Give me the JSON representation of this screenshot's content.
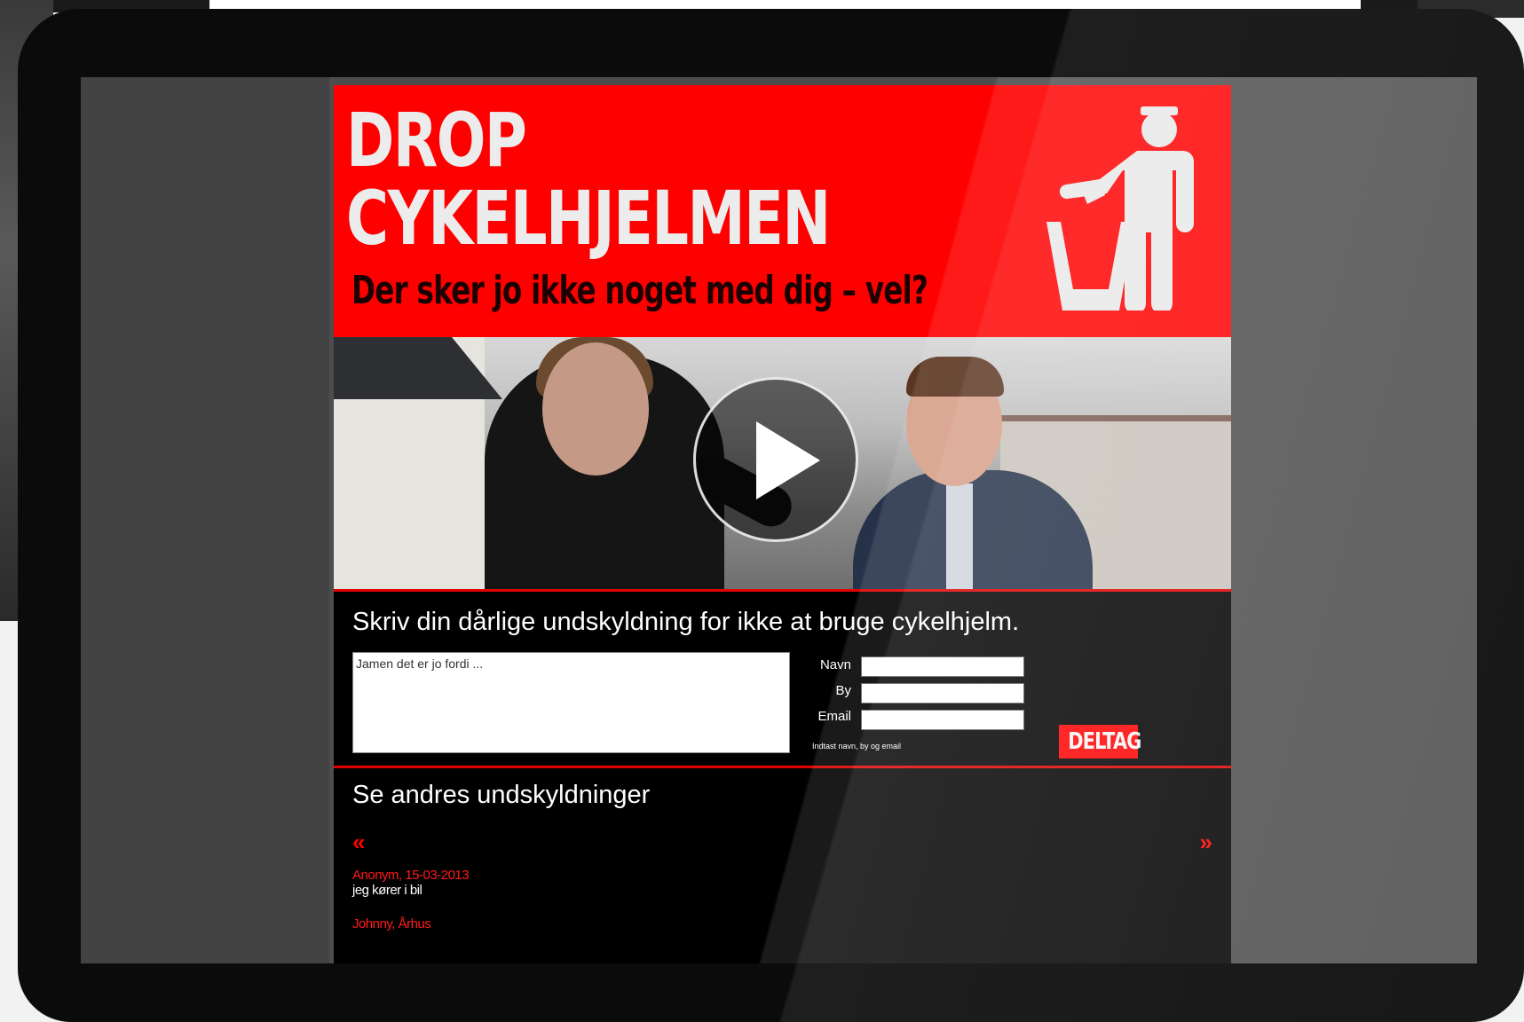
{
  "colors": {
    "brand_red": "#ff0000",
    "page_bg": "#000000",
    "text_light": "#ffffff"
  },
  "header": {
    "title_line1": "DROP",
    "title_line2": "CYKELHJELMEN",
    "tagline": "Der sker jo ikke noget med dig – vel?",
    "logo_icon": "person-trash-can-icon"
  },
  "video": {
    "play_icon": "play-icon"
  },
  "form": {
    "heading": "Skriv din dårlige undskyldning for ikke at bruge cykelhjelm.",
    "excuse_placeholder": "Jamen det er jo fordi ...",
    "name_label": "Navn",
    "city_label": "By",
    "email_label": "Email",
    "name_value": "",
    "city_value": "",
    "email_value": "",
    "hint": "Indtast navn, by og email",
    "submit_label": "DELTAG"
  },
  "others": {
    "heading": "Se andres undskyldninger",
    "prev_label": "«",
    "next_label": "»",
    "entries": [
      {
        "author": "Anonym, 15-03-2013",
        "text": "jeg kører i bil"
      },
      {
        "author": "Johnny, Århus",
        "text": ""
      }
    ]
  }
}
